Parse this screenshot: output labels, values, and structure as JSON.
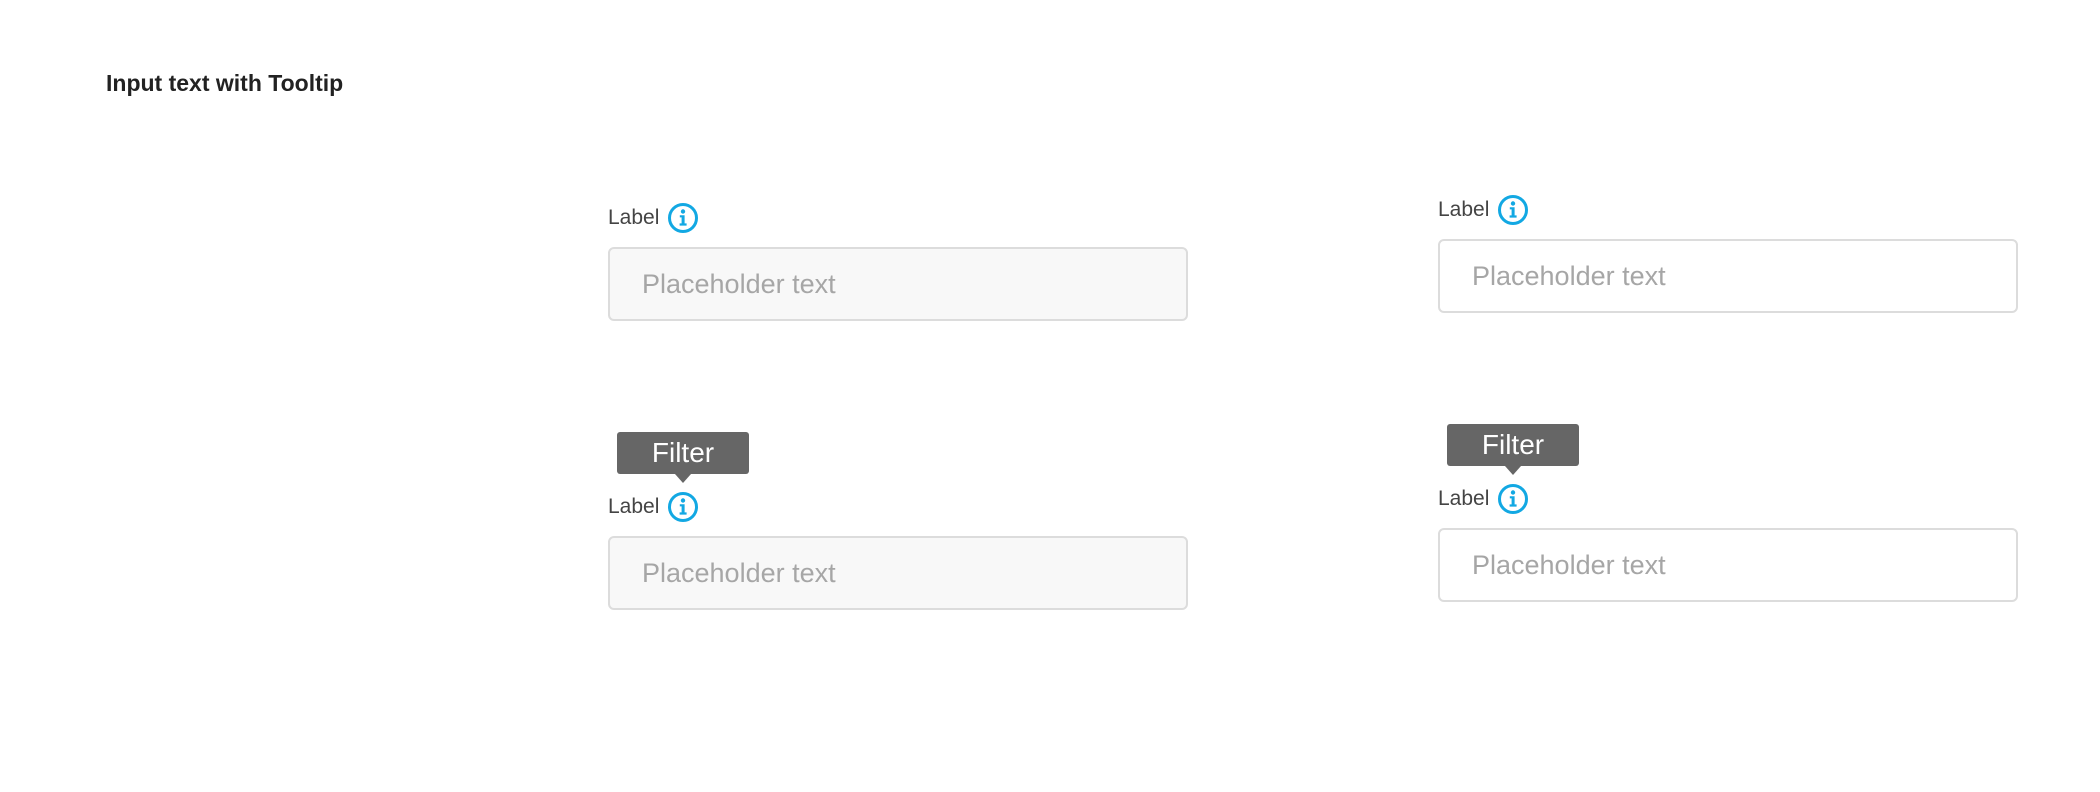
{
  "title": "Input text with Tooltip",
  "colors": {
    "info_icon": "#12a8e3",
    "tooltip_bg": "#666666",
    "input_border": "#dcdcdc",
    "input_bg_grey": "#f8f8f8",
    "placeholder": "#a6a6a6"
  },
  "fields": [
    {
      "label": "Label",
      "placeholder": "Placeholder text",
      "icon": "info-icon",
      "tooltip": null,
      "background": "grey"
    },
    {
      "label": "Label",
      "placeholder": "Placeholder text",
      "icon": "info-icon",
      "tooltip": null,
      "background": "white"
    },
    {
      "label": "Label",
      "placeholder": "Placeholder text",
      "icon": "info-icon",
      "tooltip": "Filter",
      "background": "grey"
    },
    {
      "label": "Label",
      "placeholder": "Placeholder text",
      "icon": "info-icon",
      "tooltip": "Filter",
      "background": "white"
    }
  ]
}
